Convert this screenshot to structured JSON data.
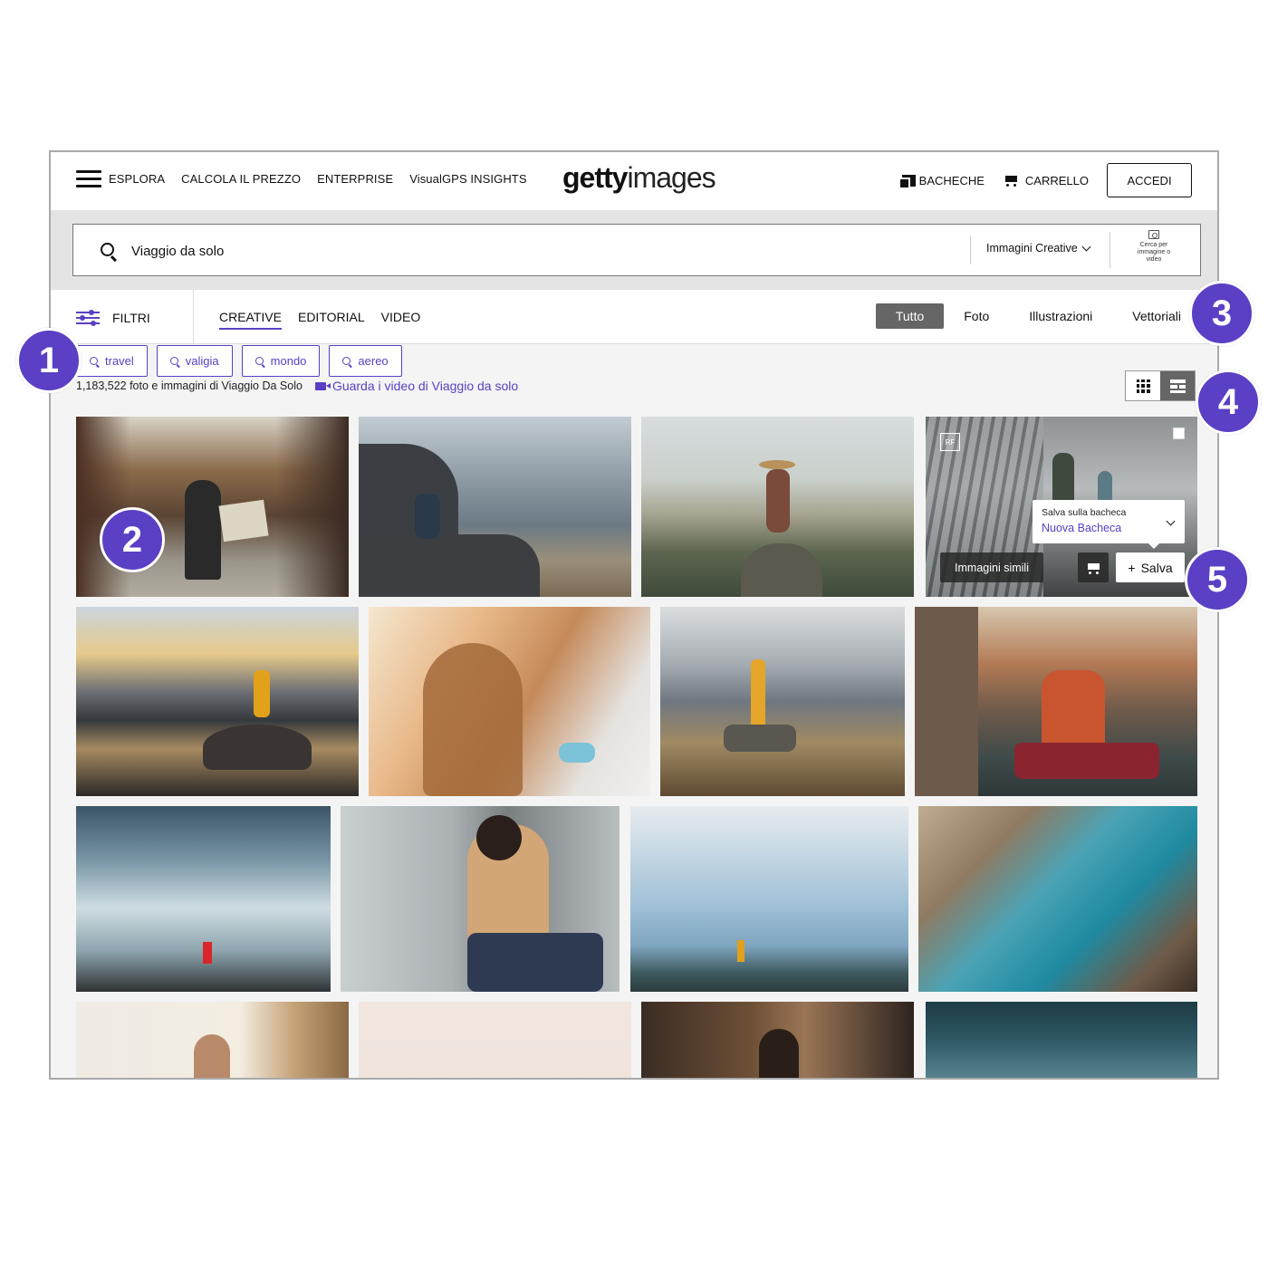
{
  "nav": {
    "links": [
      "ESPLORA",
      "CALCOLA IL PREZZO",
      "ENTERPRISE",
      "VisualGPS INSIGHTS"
    ],
    "logo_bold": "getty",
    "logo_light": "images",
    "boards_label": "BACHECHE",
    "cart_label": "CARRELLO",
    "signin_label": "ACCEDI"
  },
  "search": {
    "query": "Viaggio da solo",
    "type_selected": "Immagini Creative",
    "image_search_label_1": "Cerca per",
    "image_search_label_2": "immagine o",
    "image_search_label_3": "video"
  },
  "filters": {
    "label": "FILTRI",
    "tabs": [
      "CREATIVE",
      "EDITORIAL",
      "VIDEO"
    ],
    "active_tab": "CREATIVE",
    "media_types": [
      "Tutto",
      "Foto",
      "Illustrazioni",
      "Vettoriali"
    ],
    "active_media_type": "Tutto"
  },
  "chips": [
    "travel",
    "valigia",
    "mondo",
    "aereo"
  ],
  "results": {
    "count_text": "1,183,522 foto e immagini di Viaggio Da Solo",
    "video_link": "Guarda i video di Viaggio da solo"
  },
  "hover": {
    "rf_badge": "RF",
    "save_to_board": "Salva sulla bacheca",
    "new_board": "Nuova Bacheca",
    "similar_images": "Immagini simili",
    "save_label": "Salva"
  },
  "callouts": [
    "1",
    "2",
    "3",
    "4",
    "5"
  ],
  "colors": {
    "accent": "#5b3fc4",
    "pill": "#666666",
    "frame_bg": "#f4f4f4"
  }
}
